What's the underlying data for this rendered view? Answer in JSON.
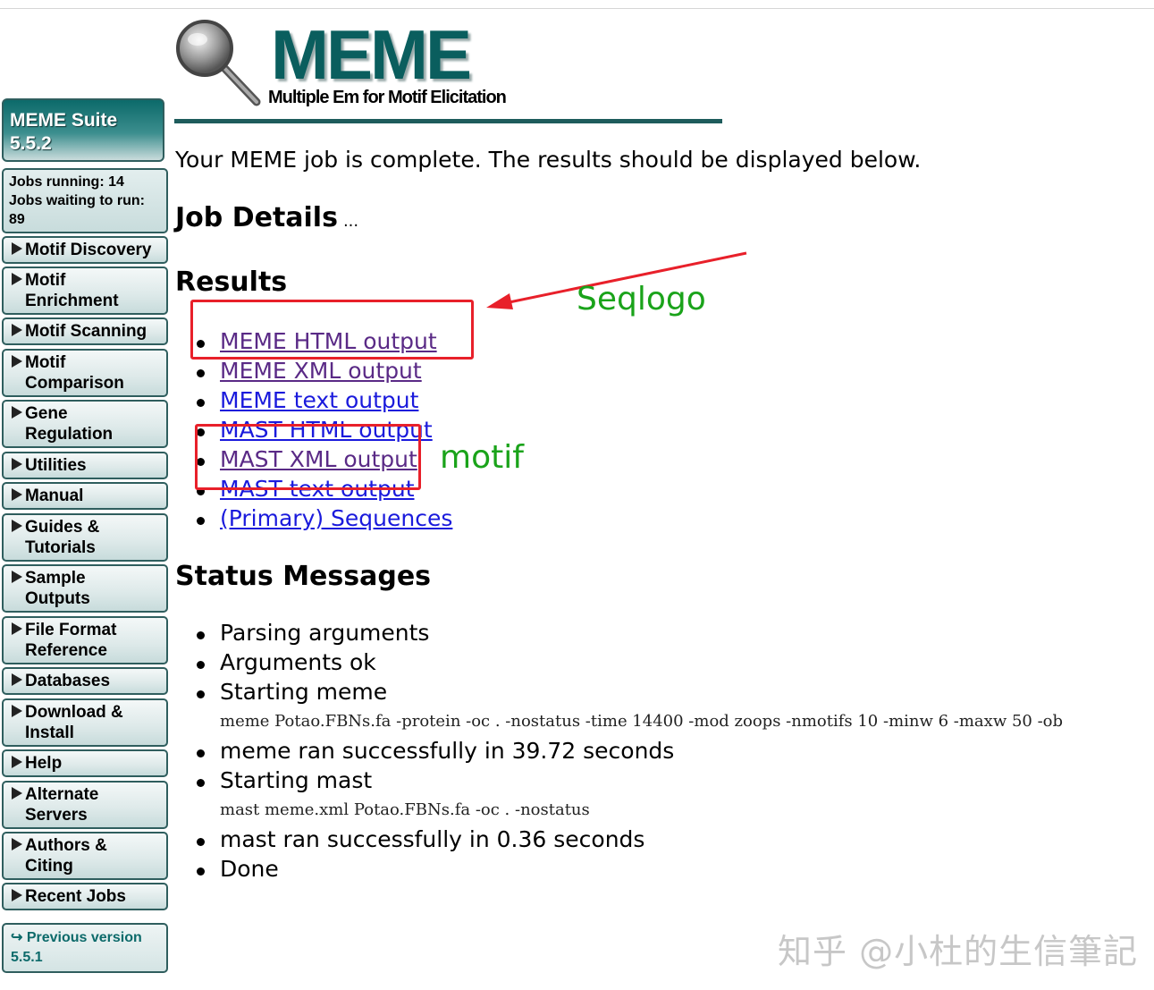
{
  "sidebar": {
    "suite_title_line1": "MEME Suite",
    "suite_title_line2": "5.5.2",
    "jobs_running": "Jobs running: 14",
    "jobs_waiting_1": "Jobs waiting to run:",
    "jobs_waiting_2": "89",
    "menu": [
      {
        "l1": "Motif Discovery",
        "l2": ""
      },
      {
        "l1": "Motif",
        "l2": "Enrichment"
      },
      {
        "l1": "Motif Scanning",
        "l2": ""
      },
      {
        "l1": "Motif",
        "l2": "Comparison"
      },
      {
        "l1": "Gene",
        "l2": "Regulation"
      },
      {
        "l1": "Utilities",
        "l2": ""
      },
      {
        "l1": "Manual",
        "l2": ""
      },
      {
        "l1": "Guides &",
        "l2": "Tutorials"
      },
      {
        "l1": "Sample",
        "l2": "Outputs"
      },
      {
        "l1": "File Format",
        "l2": "Reference"
      },
      {
        "l1": "Databases",
        "l2": ""
      },
      {
        "l1": "Download &",
        "l2": "Install"
      },
      {
        "l1": "Help",
        "l2": ""
      },
      {
        "l1": "Alternate",
        "l2": "Servers"
      },
      {
        "l1": "Authors &",
        "l2": "Citing"
      },
      {
        "l1": "Recent Jobs",
        "l2": ""
      }
    ],
    "prev_version_1": "↪ Previous version",
    "prev_version_2": "5.5.1"
  },
  "logo": {
    "title": "MEME",
    "subtitle": "Multiple Em for Motif Elicitation"
  },
  "intro": "Your MEME job is complete. The results should be displayed below.",
  "job_details": {
    "heading": "Job Details",
    "ellipsis": "..."
  },
  "results": {
    "heading": "Results",
    "links": [
      "MEME HTML output",
      "MEME XML output",
      "MEME text output",
      "MAST HTML output",
      "MAST XML output",
      "MAST text output",
      "(Primary) Sequences"
    ]
  },
  "status": {
    "heading": "Status Messages",
    "messages": [
      "Parsing arguments",
      "Arguments ok",
      "Starting meme",
      "meme Potao.FBNs.fa -protein -oc . -nostatus -time 14400 -mod zoops -nmotifs 10 -minw 6 -maxw 50 -ob",
      "meme ran successfully in 39.72 seconds",
      "Starting mast",
      "mast meme.xml Potao.FBNs.fa -oc . -nostatus",
      "mast ran successfully in 0.36 seconds",
      "Done"
    ]
  },
  "annotations": {
    "seqlogo": "Seqlogo",
    "motif": "motif",
    "box_color": "#e8202a",
    "text_color": "#1aa31a"
  },
  "watermark": "知乎 @小杜的生信筆記",
  "colors": {
    "teal": "#0a5e5e",
    "visited_link": "#5a2a86",
    "unvisited_link": "#1a1adc"
  }
}
